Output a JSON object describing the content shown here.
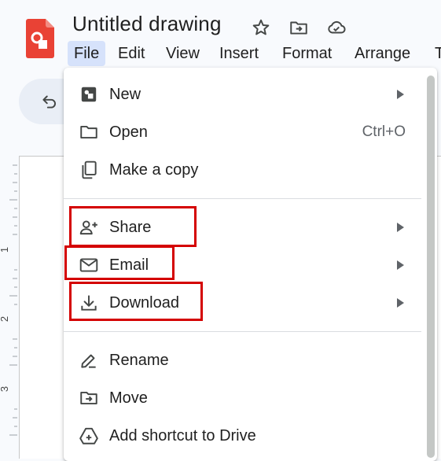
{
  "app": {
    "title": "Untitled drawing",
    "logo_icon": "google-drawings-logo",
    "title_icons": [
      "star-icon",
      "move-to-folder-icon",
      "cloud-saved-icon"
    ]
  },
  "menubar": {
    "items": [
      {
        "label": "File",
        "active": true
      },
      {
        "label": "Edit"
      },
      {
        "label": "View"
      },
      {
        "label": "Insert"
      },
      {
        "label": "Format"
      },
      {
        "label": "Arrange"
      },
      {
        "label": "T"
      }
    ]
  },
  "toolbar": {
    "undo_icon": "undo-icon"
  },
  "ruler": {
    "numbers": [
      "1",
      "2",
      "3"
    ]
  },
  "file_menu": {
    "items": [
      {
        "label": "New",
        "icon": "new-drawing-icon",
        "submenu": true
      },
      {
        "label": "Open",
        "icon": "folder-icon",
        "shortcut": "Ctrl+O"
      },
      {
        "label": "Make a copy",
        "icon": "copy-icon"
      },
      {
        "label": "Share",
        "icon": "share-person-add-icon",
        "submenu": true
      },
      {
        "label": "Email",
        "icon": "email-icon",
        "submenu": true
      },
      {
        "label": "Download",
        "icon": "download-icon",
        "submenu": true
      },
      {
        "label": "Rename",
        "icon": "rename-pencil-icon"
      },
      {
        "label": "Move",
        "icon": "move-folder-icon"
      },
      {
        "label": "Add shortcut to Drive",
        "icon": "drive-shortcut-icon"
      }
    ]
  },
  "colors": {
    "highlight": "#d40000",
    "active_menu": "#d6e2fb",
    "logo": "#e94235"
  }
}
